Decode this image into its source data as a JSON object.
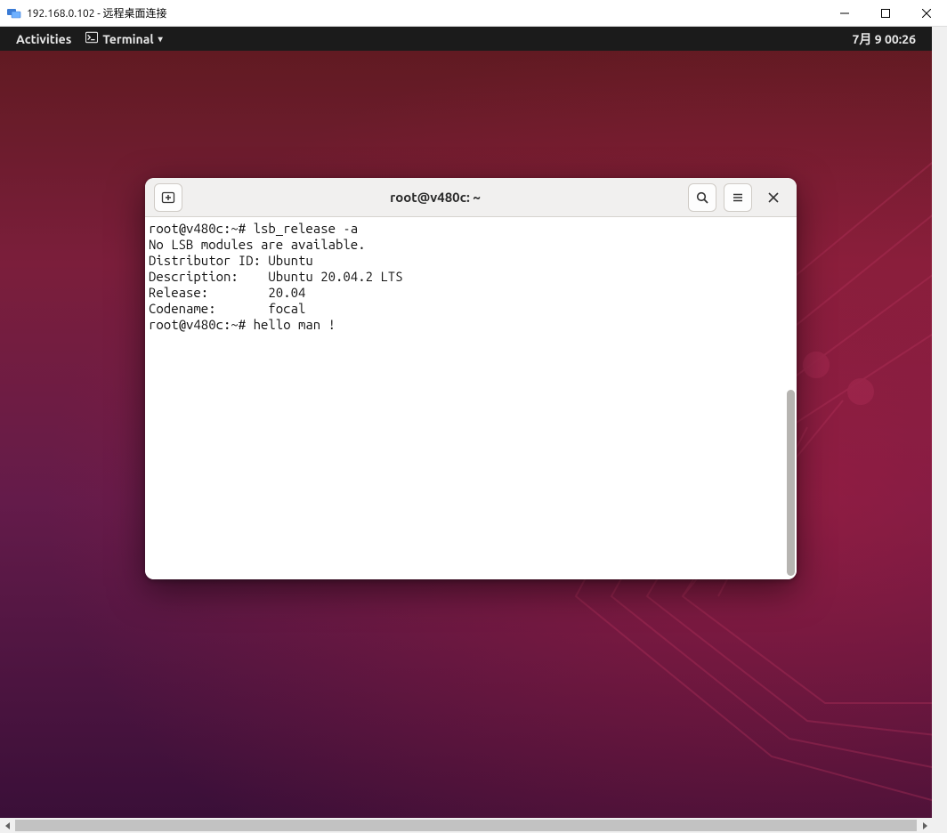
{
  "rdp": {
    "title": "192.168.0.102 - 远程桌面连接"
  },
  "gnome": {
    "activities": "Activities",
    "app_label": "Terminal",
    "clock": "7月 9 00:26"
  },
  "terminal": {
    "title": "root@v480c: ~",
    "lines": [
      "root@v480c:~# lsb_release -a",
      "No LSB modules are available.",
      "Distributor ID: Ubuntu",
      "Description:    Ubuntu 20.04.2 LTS",
      "Release:        20.04",
      "Codename:       focal",
      "root@v480c:~# hello man !"
    ]
  }
}
